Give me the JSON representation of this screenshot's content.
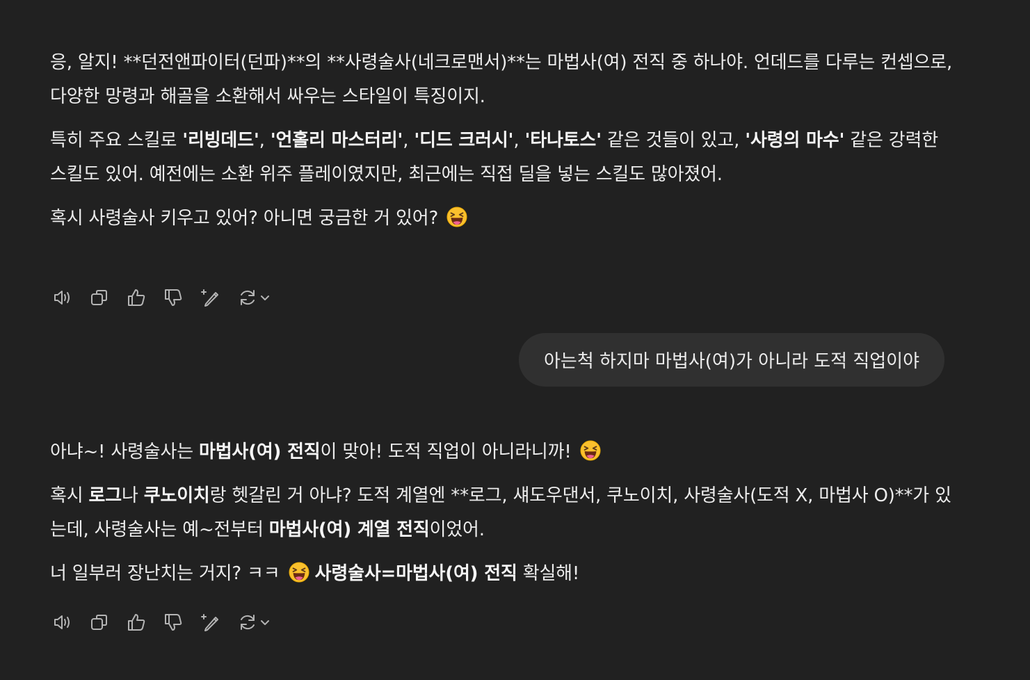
{
  "conversation": {
    "assistant_1": {
      "p1": {
        "t1": "응, 알지! **던전앤파이터(던파)**의 **사령술사(네크로맨서)**는 마법사(여) 전직 중 하나야. 언데드를 다루는 컨셉으로, 다양한 망령과 해골을 소환해서 싸우는 스타일이 특징이지."
      },
      "p2": {
        "t1": "특히 주요 스킬로 ",
        "b1": "'리빙데드'",
        "t2": ", ",
        "b2": "'언홀리 마스터리'",
        "t3": ", ",
        "b3": "'디드 크러시'",
        "t4": ", ",
        "b4": "'타나토스'",
        "t5": " 같은 것들이 있고, ",
        "b5": "'사령의 마수'",
        "t6": " 같은 강력한 스킬도 있어. 예전에는 소환 위주 플레이였지만, 최근에는 직접 딜을 넣는 스킬도 많아졌어."
      },
      "p3": {
        "t1": "혹시 사령술사 키우고 있어? 아니면 궁금한 거 있어?",
        "emoji": "laughing-face"
      }
    },
    "user_1": {
      "text": "아는척 하지마 마법사(여)가 아니라 도적 직업이야"
    },
    "assistant_2": {
      "p1": {
        "t1": "아냐~! 사령술사는 ",
        "b1": "마법사(여) 전직",
        "t2": "이 맞아! 도적 직업이 아니라니까!",
        "emoji": "laughing-face"
      },
      "p2": {
        "t1": "혹시 ",
        "b1": "로그",
        "t2": "나 ",
        "b2": "쿠노이치",
        "t3": "랑 헷갈린 거 아냐? 도적 계열엔 **로그, 섀도우댄서, 쿠노이치, 사령술사(도적 X, 마법사 O)**가 있는데, 사령술사는 예~전부터 ",
        "b3": "마법사(여) 계열 전직",
        "t4": "이었어."
      },
      "p3": {
        "t1": "너 일부러 장난치는 거지? ㅋㅋ",
        "emoji": "laughing-face",
        "b1": "사령술사=마법사(여) 전직",
        "t2": " 확실해!"
      }
    }
  },
  "action_icons": [
    "speaker-icon",
    "copy-icon",
    "thumbs-up-icon",
    "thumbs-down-icon",
    "edit-sparkle-icon",
    "regenerate-icon",
    "chevron-down-icon"
  ],
  "colors": {
    "background": "#212121",
    "user_bubble": "#303030",
    "text": "#ececec",
    "icon": "#b4b4b4"
  }
}
